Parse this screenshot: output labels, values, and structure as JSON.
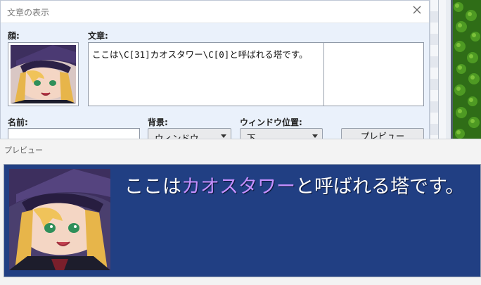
{
  "dialog": {
    "title": "文章の表示",
    "face_label": "顔:",
    "message_label": "文章:",
    "message_text": "ここは\\C[31]カオスタワー\\C[0]と呼ばれる塔です。",
    "name_label": "名前:",
    "name_value": "",
    "background_label": "背景:",
    "background_value": "ウィンドウ",
    "window_position_label": "ウィンドウ位置:",
    "window_position_value": "下",
    "preview_button": "プレビュー"
  },
  "preview": {
    "title": "プレビュー",
    "text_before": "ここは",
    "text_highlight": "カオスタワー",
    "text_after": "と呼ばれる塔です。",
    "highlight_color": "#c690ff",
    "box_color": "#213f83"
  },
  "icons": [
    "close-icon",
    "face-portrait"
  ]
}
